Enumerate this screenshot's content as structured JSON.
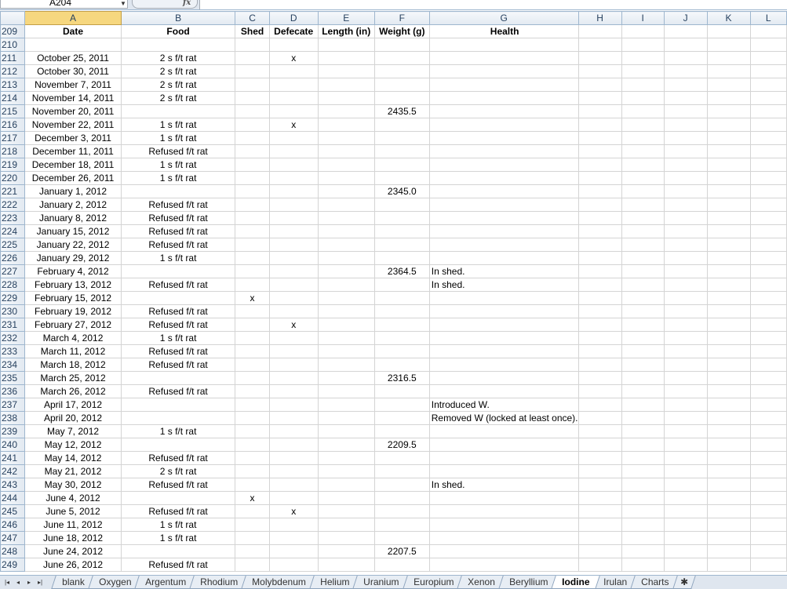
{
  "formula_bar": {
    "name_box": "A204",
    "fx": "fx",
    "formula": ""
  },
  "columns": [
    "A",
    "B",
    "C",
    "D",
    "E",
    "F",
    "G",
    "H",
    "I",
    "J",
    "K",
    "L"
  ],
  "header_row": {
    "row": "209",
    "cells": [
      "Date",
      "Food",
      "Shed",
      "Defecate",
      "Length (in)",
      "Weight (g)",
      "Health",
      "",
      "",
      "",
      "",
      ""
    ]
  },
  "rows": [
    {
      "row": "210",
      "cells": [
        "",
        "",
        "",
        "",
        "",
        "",
        "",
        "",
        "",
        "",
        "",
        ""
      ]
    },
    {
      "row": "211",
      "cells": [
        "October 25, 2011",
        "2 s f/t rat",
        "",
        "x",
        "",
        "",
        "",
        "",
        "",
        "",
        "",
        ""
      ]
    },
    {
      "row": "212",
      "cells": [
        "October 30, 2011",
        "2 s f/t rat",
        "",
        "",
        "",
        "",
        "",
        "",
        "",
        "",
        "",
        ""
      ]
    },
    {
      "row": "213",
      "cells": [
        "November 7, 2011",
        "2 s f/t rat",
        "",
        "",
        "",
        "",
        "",
        "",
        "",
        "",
        "",
        ""
      ]
    },
    {
      "row": "214",
      "cells": [
        "November 14, 2011",
        "2 s f/t rat",
        "",
        "",
        "",
        "",
        "",
        "",
        "",
        "",
        "",
        ""
      ]
    },
    {
      "row": "215",
      "cells": [
        "November 20, 2011",
        "",
        "",
        "",
        "",
        "2435.5",
        "",
        "",
        "",
        "",
        "",
        ""
      ]
    },
    {
      "row": "216",
      "cells": [
        "November 22, 2011",
        "1 s f/t rat",
        "",
        "x",
        "",
        "",
        "",
        "",
        "",
        "",
        "",
        ""
      ]
    },
    {
      "row": "217",
      "cells": [
        "December 3, 2011",
        "1 s f/t rat",
        "",
        "",
        "",
        "",
        "",
        "",
        "",
        "",
        "",
        ""
      ]
    },
    {
      "row": "218",
      "cells": [
        "December 11, 2011",
        "Refused f/t rat",
        "",
        "",
        "",
        "",
        "",
        "",
        "",
        "",
        "",
        ""
      ]
    },
    {
      "row": "219",
      "cells": [
        "December 18, 2011",
        "1 s f/t rat",
        "",
        "",
        "",
        "",
        "",
        "",
        "",
        "",
        "",
        ""
      ]
    },
    {
      "row": "220",
      "cells": [
        "December 26, 2011",
        "1 s f/t rat",
        "",
        "",
        "",
        "",
        "",
        "",
        "",
        "",
        "",
        ""
      ]
    },
    {
      "row": "221",
      "cells": [
        "January 1, 2012",
        "",
        "",
        "",
        "",
        "2345.0",
        "",
        "",
        "",
        "",
        "",
        ""
      ]
    },
    {
      "row": "222",
      "cells": [
        "January 2, 2012",
        "Refused f/t rat",
        "",
        "",
        "",
        "",
        "",
        "",
        "",
        "",
        "",
        ""
      ]
    },
    {
      "row": "223",
      "cells": [
        "January 8, 2012",
        "Refused f/t rat",
        "",
        "",
        "",
        "",
        "",
        "",
        "",
        "",
        "",
        ""
      ]
    },
    {
      "row": "224",
      "cells": [
        "January 15, 2012",
        "Refused f/t rat",
        "",
        "",
        "",
        "",
        "",
        "",
        "",
        "",
        "",
        ""
      ]
    },
    {
      "row": "225",
      "cells": [
        "January 22, 2012",
        "Refused f/t rat",
        "",
        "",
        "",
        "",
        "",
        "",
        "",
        "",
        "",
        ""
      ]
    },
    {
      "row": "226",
      "cells": [
        "January 29, 2012",
        "1 s f/t rat",
        "",
        "",
        "",
        "",
        "",
        "",
        "",
        "",
        "",
        ""
      ]
    },
    {
      "row": "227",
      "cells": [
        "February 4, 2012",
        "",
        "",
        "",
        "",
        "2364.5",
        "In shed.",
        "",
        "",
        "",
        "",
        ""
      ]
    },
    {
      "row": "228",
      "cells": [
        "February 13, 2012",
        "Refused f/t rat",
        "",
        "",
        "",
        "",
        "In shed.",
        "",
        "",
        "",
        "",
        ""
      ]
    },
    {
      "row": "229",
      "cells": [
        "February 15, 2012",
        "",
        "x",
        "",
        "",
        "",
        "",
        "",
        "",
        "",
        "",
        ""
      ]
    },
    {
      "row": "230",
      "cells": [
        "February 19, 2012",
        "Refused f/t rat",
        "",
        "",
        "",
        "",
        "",
        "",
        "",
        "",
        "",
        ""
      ]
    },
    {
      "row": "231",
      "cells": [
        "February 27, 2012",
        "Refused f/t rat",
        "",
        "x",
        "",
        "",
        "",
        "",
        "",
        "",
        "",
        ""
      ]
    },
    {
      "row": "232",
      "cells": [
        "March 4, 2012",
        "1 s f/t rat",
        "",
        "",
        "",
        "",
        "",
        "",
        "",
        "",
        "",
        ""
      ]
    },
    {
      "row": "233",
      "cells": [
        "March 11, 2012",
        "Refused f/t rat",
        "",
        "",
        "",
        "",
        "",
        "",
        "",
        "",
        "",
        ""
      ]
    },
    {
      "row": "234",
      "cells": [
        "March 18, 2012",
        "Refused f/t rat",
        "",
        "",
        "",
        "",
        "",
        "",
        "",
        "",
        "",
        ""
      ]
    },
    {
      "row": "235",
      "cells": [
        "March 25, 2012",
        "",
        "",
        "",
        "",
        "2316.5",
        "",
        "",
        "",
        "",
        "",
        ""
      ]
    },
    {
      "row": "236",
      "cells": [
        "March 26, 2012",
        "Refused f/t rat",
        "",
        "",
        "",
        "",
        "",
        "",
        "",
        "",
        "",
        ""
      ]
    },
    {
      "row": "237",
      "cells": [
        "April 17, 2012",
        "",
        "",
        "",
        "",
        "",
        "Introduced W.",
        "",
        "",
        "",
        "",
        ""
      ]
    },
    {
      "row": "238",
      "cells": [
        "April 20, 2012",
        "",
        "",
        "",
        "",
        "",
        "Removed W (locked at least once).",
        "",
        "",
        "",
        "",
        ""
      ]
    },
    {
      "row": "239",
      "cells": [
        "May 7, 2012",
        "1 s f/t rat",
        "",
        "",
        "",
        "",
        "",
        "",
        "",
        "",
        "",
        ""
      ]
    },
    {
      "row": "240",
      "cells": [
        "May 12, 2012",
        "",
        "",
        "",
        "",
        "2209.5",
        "",
        "",
        "",
        "",
        "",
        ""
      ]
    },
    {
      "row": "241",
      "cells": [
        "May 14, 2012",
        "Refused f/t rat",
        "",
        "",
        "",
        "",
        "",
        "",
        "",
        "",
        "",
        ""
      ]
    },
    {
      "row": "242",
      "cells": [
        "May 21, 2012",
        "2 s f/t rat",
        "",
        "",
        "",
        "",
        "",
        "",
        "",
        "",
        "",
        ""
      ]
    },
    {
      "row": "243",
      "cells": [
        "May 30, 2012",
        "Refused f/t rat",
        "",
        "",
        "",
        "",
        "In shed.",
        "",
        "",
        "",
        "",
        ""
      ]
    },
    {
      "row": "244",
      "cells": [
        "June 4, 2012",
        "",
        "x",
        "",
        "",
        "",
        "",
        "",
        "",
        "",
        "",
        ""
      ]
    },
    {
      "row": "245",
      "cells": [
        "June 5, 2012",
        "Refused f/t rat",
        "",
        "x",
        "",
        "",
        "",
        "",
        "",
        "",
        "",
        ""
      ]
    },
    {
      "row": "246",
      "cells": [
        "June 11, 2012",
        "1 s f/t rat",
        "",
        "",
        "",
        "",
        "",
        "",
        "",
        "",
        "",
        ""
      ]
    },
    {
      "row": "247",
      "cells": [
        "June 18, 2012",
        "1 s f/t rat",
        "",
        "",
        "",
        "",
        "",
        "",
        "",
        "",
        "",
        ""
      ]
    },
    {
      "row": "248",
      "cells": [
        "June 24, 2012",
        "",
        "",
        "",
        "",
        "2207.5",
        "",
        "",
        "",
        "",
        "",
        ""
      ]
    },
    {
      "row": "249",
      "cells": [
        "June 26, 2012",
        "Refused f/t rat",
        "",
        "",
        "",
        "",
        "",
        "",
        "",
        "",
        "",
        ""
      ]
    }
  ],
  "sheet_tabs": [
    "blank",
    "Oxygen",
    "Argentum",
    "Rhodium",
    "Molybdenum",
    "Helium",
    "Uranium",
    "Europium",
    "Xenon",
    "Beryllium",
    "Iodine",
    "Irulan",
    "Charts"
  ],
  "active_tab": "Iodine",
  "nav_buttons": [
    "|◂",
    "◂",
    "▸",
    "▸|"
  ],
  "new_sheet_icon": "✱"
}
